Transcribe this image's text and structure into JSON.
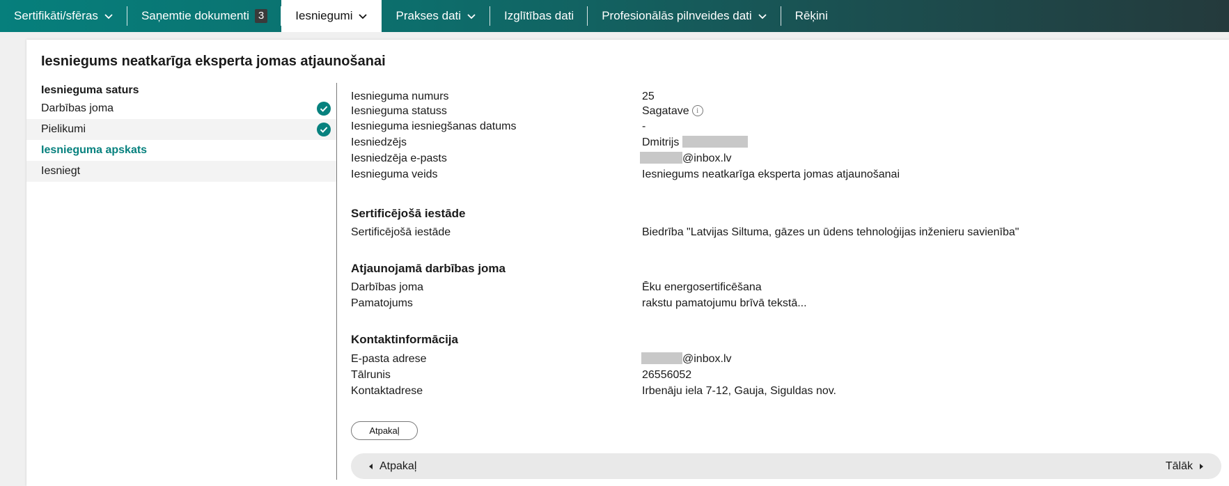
{
  "nav": {
    "certificates": "Sertifikāti/sfēras",
    "received_docs": "Saņemtie dokumenti",
    "received_docs_count": "3",
    "submissions": "Iesniegumi",
    "practice": "Prakses dati",
    "education": "Izglītības dati",
    "professional": "Profesionālās pilnveides dati",
    "invoices": "Rēķini"
  },
  "page": {
    "title": "Iesniegums neatkarīga eksperta jomas atjaunošanai"
  },
  "sidebar": {
    "heading": "Iesnieguma saturs",
    "items": [
      {
        "label": "Darbības joma",
        "done": true
      },
      {
        "label": "Pielikumi",
        "done": true
      },
      {
        "label": "Iesnieguma apskats",
        "current": true
      },
      {
        "label": "Iesniegt"
      }
    ]
  },
  "details": {
    "general": [
      {
        "label": "Iesnieguma numurs",
        "value": "25"
      },
      {
        "label": "Iesnieguma statuss",
        "value": "Sagatave"
      },
      {
        "label": "Iesnieguma iesniegšanas datums",
        "value": "-"
      },
      {
        "label": "Iesniedzējs",
        "value": "Dmitrijs"
      },
      {
        "label": "Iesniedzēja e-pasts",
        "value": "@inbox.lv"
      },
      {
        "label": "Iesnieguma veids",
        "value": "Iesniegums neatkarīga eksperta jomas atjaunošanai"
      }
    ],
    "cert_body": {
      "title": "Sertificējošā iestāde",
      "label": "Sertificējošā iestāde",
      "value": "Biedrība \"Latvijas Siltuma, gāzes un ūdens tehnoloģijas inženieru savienība\""
    },
    "field": {
      "title": "Atjaunojamā darbības joma",
      "rows": [
        {
          "label": "Darbības joma",
          "value": "Ēku energosertificēšana"
        },
        {
          "label": "Pamatojums",
          "value": "rakstu pamatojumu brīvā tekstā..."
        }
      ]
    },
    "contact": {
      "title": "Kontaktinformācija",
      "rows": [
        {
          "label": "E-pasta adrese",
          "value": "@inbox.lv"
        },
        {
          "label": "Tālrunis",
          "value": "26556052"
        },
        {
          "label": "Kontaktadrese",
          "value": "Irbenāju iela 7-12, Gauja, Siguldas nov."
        }
      ]
    }
  },
  "actions": {
    "back_button": "Atpakaļ",
    "pager_prev": "Atpakaļ",
    "pager_next": "Tālāk"
  },
  "colors": {
    "accent": "#07817e",
    "nav_start": "#067f7c",
    "nav_end": "#243a3c"
  },
  "icons": {
    "chevron": "chevron-down-icon",
    "check": "check-circle-icon",
    "info": "info-icon"
  }
}
